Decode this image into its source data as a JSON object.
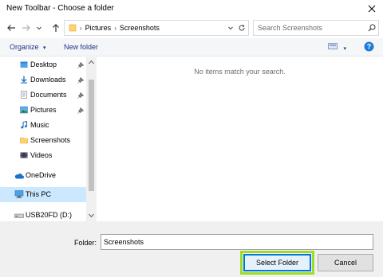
{
  "window": {
    "title": "New Toolbar - Choose a folder"
  },
  "address": {
    "crumbs": [
      "Pictures",
      "Screenshots"
    ]
  },
  "search": {
    "placeholder": "Search Screenshots"
  },
  "toolbar": {
    "organize_label": "Organize",
    "new_folder_label": "New folder"
  },
  "navpane": {
    "items": [
      {
        "label": "Desktop",
        "icon": "desktop-folder-icon",
        "pinned": true
      },
      {
        "label": "Downloads",
        "icon": "downloads-folder-icon",
        "pinned": true
      },
      {
        "label": "Documents",
        "icon": "documents-folder-icon",
        "pinned": true
      },
      {
        "label": "Pictures",
        "icon": "pictures-folder-icon",
        "pinned": true
      },
      {
        "label": "Music",
        "icon": "music-folder-icon",
        "pinned": false
      },
      {
        "label": "Screenshots",
        "icon": "folder-icon",
        "pinned": false
      },
      {
        "label": "Videos",
        "icon": "videos-folder-icon",
        "pinned": false
      },
      {
        "label": "OneDrive",
        "icon": "onedrive-cloud-icon",
        "pinned": false
      },
      {
        "label": "This PC",
        "icon": "this-pc-icon",
        "pinned": false,
        "selected": true
      },
      {
        "label": "USB20FD (D:)",
        "icon": "usb-drive-icon",
        "pinned": false
      }
    ]
  },
  "content": {
    "empty_message": "No items match your search."
  },
  "footer": {
    "folder_label": "Folder:",
    "folder_value": "Screenshots",
    "select_button": "Select Folder",
    "cancel_button": "Cancel"
  },
  "colors": {
    "accent": "#0078d7",
    "selection": "#cce8ff",
    "highlight_outline": "#9cdd2a",
    "link_text": "#1e3287"
  }
}
